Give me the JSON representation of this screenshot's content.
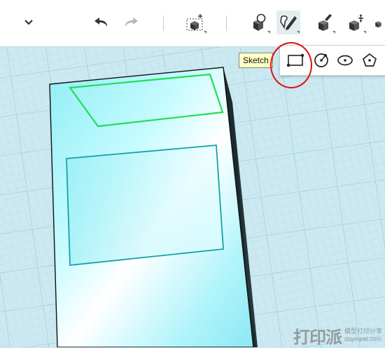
{
  "toolbar": {
    "items": [
      {
        "name": "collapse-chevron-icon"
      },
      {
        "name": "undo-icon"
      },
      {
        "name": "redo-icon"
      },
      {
        "name": "primitive-box-icon"
      },
      {
        "name": "sketch-shape-icon"
      },
      {
        "name": "sketch-pen-icon"
      },
      {
        "name": "modify-paint-icon"
      },
      {
        "name": "transform-move-icon"
      },
      {
        "name": "group-cube-icon"
      }
    ]
  },
  "tooltip": {
    "text": "Sketch"
  },
  "sketch_tools": [
    {
      "name": "rectangle-tool-icon"
    },
    {
      "name": "circle-tool-icon"
    },
    {
      "name": "ellipse-tool-icon"
    },
    {
      "name": "polygon-tool-icon"
    }
  ],
  "colors": {
    "grid_line": "#9ecfe0",
    "model_face": "#aef0f5",
    "model_side": "#26383a",
    "top_face_outline": "#22dd55",
    "front_rect_outline": "#17a2a8",
    "annotation_ring": "#e01010"
  },
  "watermark": {
    "big": "打印派",
    "line1": "模型打印分享",
    "line2": "dayinpai.com"
  }
}
